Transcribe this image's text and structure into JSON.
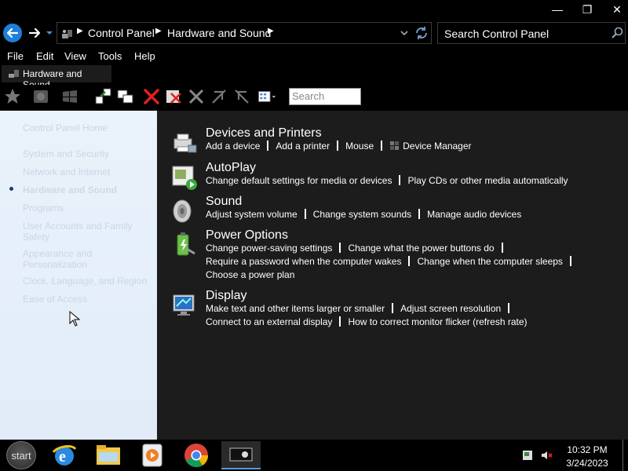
{
  "window": {
    "minimize_glyph": "—",
    "maximize_glyph": "❐",
    "close_glyph": "✕"
  },
  "address": {
    "breadcrumbs": [
      "Control Panel",
      "Hardware and Sound"
    ],
    "search_placeholder": "Search Control Panel"
  },
  "menu": {
    "items": [
      "File",
      "Edit",
      "View",
      "Tools",
      "Help"
    ]
  },
  "tab": {
    "label": "Hardware and Sound"
  },
  "toolbar": {
    "search_placeholder": "Search"
  },
  "sidebar": {
    "items": [
      "Control Panel Home",
      "System and Security",
      "Network and Internet",
      "Hardware and Sound",
      "Programs",
      "User Accounts and Family Safety",
      "Appearance and Personalization",
      "Clock, Language, and Region",
      "Ease of Access"
    ],
    "active": "Hardware and Sound"
  },
  "categories": [
    {
      "title": "Devices and Printers",
      "icon": "printer-icon",
      "lines": [
        [
          "Add a device",
          "Add a printer",
          "Mouse",
          "Device Manager"
        ]
      ]
    },
    {
      "title": "AutoPlay",
      "icon": "autoplay-icon",
      "lines": [
        [
          "Change default settings for media or devices",
          "Play CDs or other media automatically"
        ]
      ]
    },
    {
      "title": "Sound",
      "icon": "speaker-icon",
      "lines": [
        [
          "Adjust system volume",
          "Change system sounds",
          "Manage audio devices"
        ]
      ]
    },
    {
      "title": "Power Options",
      "icon": "battery-icon",
      "lines": [
        [
          "Change power-saving settings",
          "Change what the power buttons do"
        ],
        [
          "Require a password when the computer wakes",
          "Change when the computer sleeps"
        ],
        [
          "Choose a power plan"
        ]
      ]
    },
    {
      "title": "Display",
      "icon": "monitor-icon",
      "lines": [
        [
          "Make text and other items larger or smaller",
          "Adjust screen resolution"
        ],
        [
          "Connect to an external display",
          "How to correct monitor flicker (refresh rate)"
        ]
      ]
    }
  ],
  "taskbar": {
    "start_label": "start",
    "time": "10:32 PM",
    "date": "3/24/2023"
  },
  "colors": {
    "accent": "#1e7fd8",
    "sidebar_bg": "#e6eff9",
    "main_bg": "#1c1c1c"
  }
}
